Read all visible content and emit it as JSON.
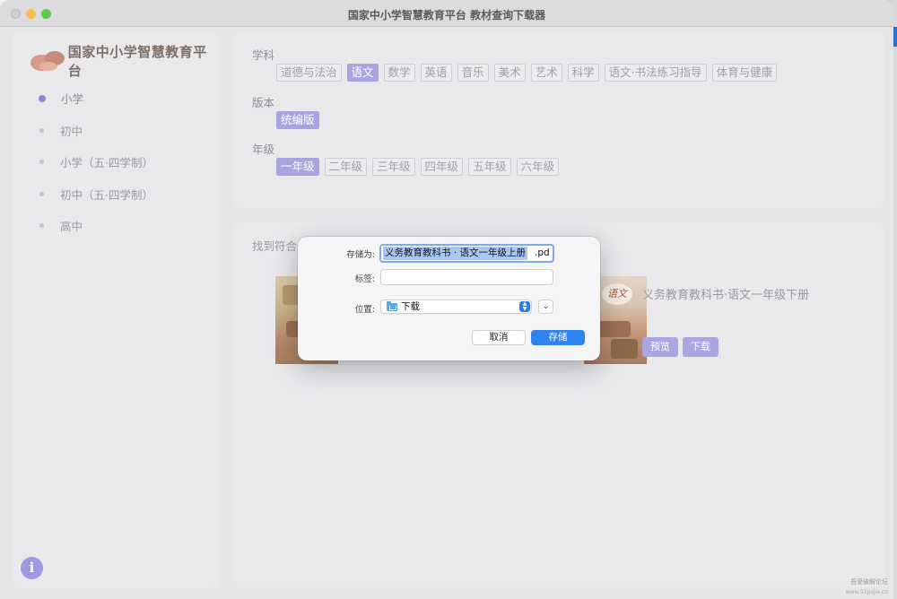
{
  "window": {
    "title": "国家中小学智慧教育平台 教材查询下载器"
  },
  "sidebar": {
    "logo_text": "国家中小学智慧教育平台",
    "items": [
      {
        "label": "小学"
      },
      {
        "label": "初中"
      },
      {
        "label": "小学（五·四学制）"
      },
      {
        "label": "初中（五·四学制）"
      },
      {
        "label": "高中"
      }
    ],
    "active_index": 0,
    "info_glyph": "i"
  },
  "filters": {
    "subject_label": "学科",
    "subjects": [
      "道德与法治",
      "语文",
      "数学",
      "英语",
      "音乐",
      "美术",
      "艺术",
      "科学",
      "语文·书法练习指导",
      "体育与健康"
    ],
    "subject_selected": "语文",
    "edition_label": "版本",
    "editions": [
      "统编版"
    ],
    "edition_selected": "统编版",
    "grade_label": "年级",
    "grades": [
      "一年级",
      "二年级",
      "三年级",
      "四年级",
      "五年级",
      "六年级"
    ],
    "grade_selected": "一年级"
  },
  "results": {
    "title": "找到符合",
    "books": [
      {
        "title": "义务教育教科书·语文一年级下册",
        "preview_label": "预览",
        "download_label": "下载",
        "cover_text": "语文"
      }
    ]
  },
  "save_dialog": {
    "save_as_label": "存储为:",
    "filename_selected": "义务教育教科书 · 语文一年级上册",
    "filename_extension": ".pd",
    "tags_label": "标签:",
    "tags_value": "",
    "location_label": "位置:",
    "location_value": "下载",
    "cancel_label": "取消",
    "save_label": "存储"
  },
  "watermark": {
    "line1": "吾爱破解论坛",
    "line2": "www.52pojie.cn"
  },
  "colors": {
    "accent": "#a9a4df",
    "save_button": "#2f83ee",
    "selection": "#a7c8f7"
  }
}
